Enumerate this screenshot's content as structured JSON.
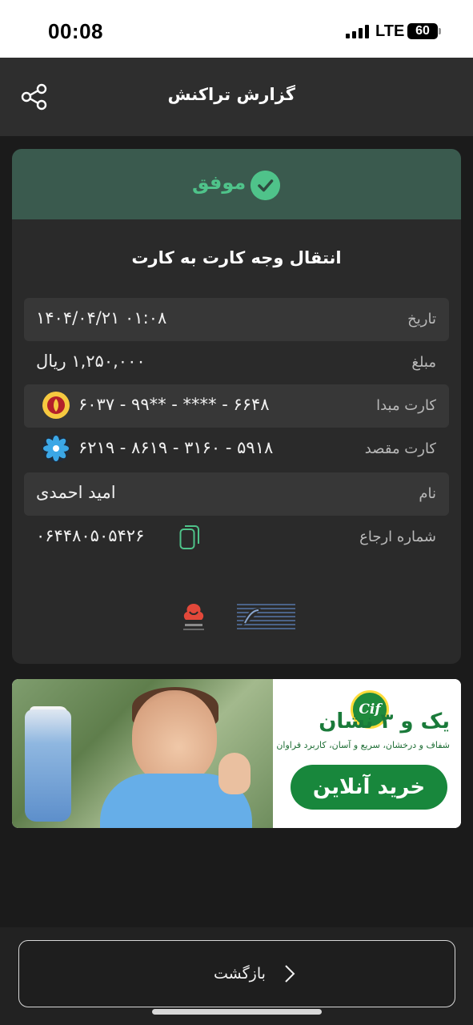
{
  "status_bar": {
    "time": "00:08",
    "network": "LTE",
    "battery": "60"
  },
  "header": {
    "title": "گزارش تراکنش",
    "share_icon": "share-icon"
  },
  "receipt": {
    "status": "موفق",
    "status_icon": "check-circle-icon",
    "title": "انتقال وجه کارت به کارت",
    "rows": [
      {
        "label": "تاریخ",
        "value": "۱۴۰۴/۰۴/۲۱ ۰۱:۰۸"
      },
      {
        "label": "مبلغ",
        "value": "۱,۲۵۰,۰۰۰ ریال"
      },
      {
        "label": "کارت مبدا",
        "value": "۶۰۳۷ - ۹۹** - **** - ۶۶۴۸",
        "icon": "bank-melli-icon"
      },
      {
        "label": "کارت مقصد",
        "value": "۶۲۱۹ - ۸۶۱۹ - ۳۱۶۰ - ۵۹۱۸",
        "icon": "bank-saman-icon"
      },
      {
        "label": "نام",
        "value": "امید احمدی"
      },
      {
        "label": "شماره ارجاع",
        "value": "۰۶۴۴۸۰۵۰۵۴۲۶",
        "icon": "copy-icon"
      }
    ],
    "footer_logos": [
      "asan-pardakht-logo",
      "partner-logo"
    ]
  },
  "ad_banner": {
    "headline": "یک      و ۳ نشان",
    "brand": "Cif",
    "subtitle": "شفاف و درخشان، سریع و آسان، کاربرد فراوان",
    "cta": "خرید آنلاین"
  },
  "actions": {
    "back_label": "بازگشت"
  },
  "colors": {
    "background": "#1b1b1b",
    "header": "#2e2e2e",
    "card": "#2a2a2a",
    "success_strip": "#3a5a4e",
    "success_text": "#4fc38a",
    "row_shaded": "#373737"
  }
}
